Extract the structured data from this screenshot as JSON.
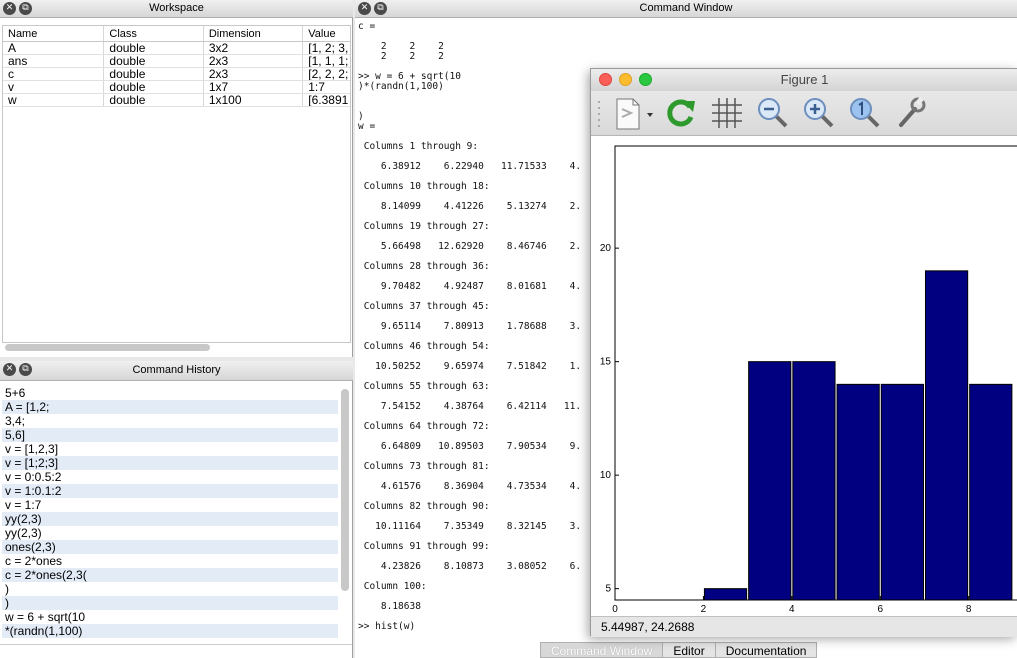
{
  "workspace": {
    "title": "Workspace",
    "columns": [
      "Name",
      "Class",
      "Dimension",
      "Value"
    ],
    "rows": [
      {
        "name": "A",
        "class": "double",
        "dim": "3x2",
        "value": "[1, 2; 3,"
      },
      {
        "name": "ans",
        "class": "double",
        "dim": "2x3",
        "value": "[1, 1, 1;"
      },
      {
        "name": "c",
        "class": "double",
        "dim": "2x3",
        "value": "[2, 2, 2;"
      },
      {
        "name": "v",
        "class": "double",
        "dim": "1x7",
        "value": "1:7"
      },
      {
        "name": "w",
        "class": "double",
        "dim": "1x100",
        "value": "[6.3891"
      }
    ]
  },
  "history": {
    "title": "Command History",
    "items": [
      "5+6",
      "A = [1,2;",
      "3,4;",
      "5,6]",
      "v = [1,2,3]",
      "v = [1;2;3]",
      "v = 0:0.5:2",
      "v = 1:0.1:2",
      "v = 1:7",
      "yy(2,3)",
      "yy(2,3)",
      "ones(2,3)",
      "c = 2*ones",
      "c = 2*ones(2,3(",
      ")",
      ")",
      "w = 6 + sqrt(10",
      "*(randn(1,100)"
    ]
  },
  "command_window": {
    "title": "Command Window",
    "lines": [
      "c =",
      "",
      "    2    2    2",
      "    2    2    2",
      "",
      ">> w = 6 + sqrt(10",
      ")*(randn(1,100)",
      "",
      "",
      ")",
      "w =",
      "",
      " Columns 1 through 9:",
      "",
      "    6.38912    6.22940   11.71533    4.",
      "",
      " Columns 10 through 18:",
      "",
      "    8.14099    4.41226    5.13274    2.",
      "",
      " Columns 19 through 27:",
      "",
      "    5.66498   12.62920    8.46746    2.",
      "",
      " Columns 28 through 36:",
      "",
      "    9.70482    4.92487    8.01681    4.",
      "",
      " Columns 37 through 45:",
      "",
      "    9.65114    7.80913    1.78688    3.",
      "",
      " Columns 46 through 54:",
      "",
      "   10.50252    9.65974    7.51842    1.",
      "",
      " Columns 55 through 63:",
      "",
      "    7.54152    4.38764    6.42114   11.",
      "",
      " Columns 64 through 72:",
      "",
      "    6.64809   10.89503    7.90534    9.",
      "",
      " Columns 73 through 81:",
      "",
      "    4.61576    8.36904    4.73534    4.",
      "",
      " Columns 82 through 90:",
      "",
      "   10.11164    7.35349    8.32145    3.",
      "",
      " Columns 91 through 99:",
      "",
      "    4.23826    8.10873    3.08052    6.",
      "",
      " Column 100:",
      "",
      "    8.18638",
      "",
      ">> hist(w)"
    ],
    "tabs": [
      "Command Window",
      "Editor",
      "Documentation"
    ]
  },
  "figure": {
    "title": "Figure 1",
    "toolbar": [
      "new-figure-icon",
      "refresh-icon",
      "grid-icon",
      "zoom-out-icon",
      "zoom-in-icon",
      "zoom-reset-icon",
      "wrench-icon"
    ],
    "status": "5.44987,  24.2688"
  },
  "chart_data": {
    "type": "bar",
    "x": [
      2.5,
      3.5,
      4.5,
      5.5,
      6.5,
      7.5,
      8.5
    ],
    "values": [
      5,
      15,
      15,
      14,
      14,
      19,
      14
    ],
    "bar_width": 1,
    "xlim": [
      0,
      9.5
    ],
    "ylim": [
      4.5,
      24.5
    ],
    "xticks": [
      0,
      2,
      4,
      6,
      8
    ],
    "yticks": [
      5,
      10,
      15,
      20
    ],
    "color": "#000080",
    "grid": false
  }
}
